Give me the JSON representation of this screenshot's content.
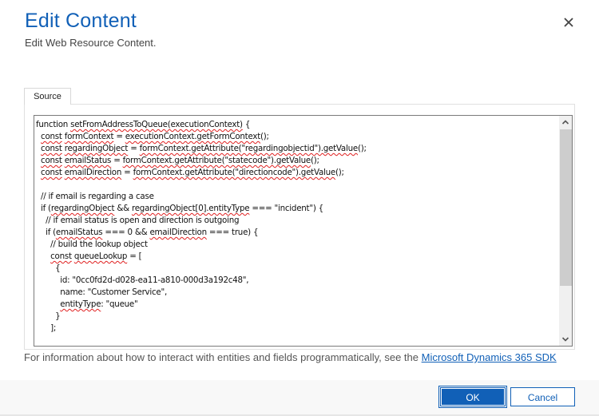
{
  "dialog": {
    "title": "Edit Content",
    "subtitle": "Edit Web Resource Content."
  },
  "tabs": [
    {
      "label": "Source",
      "active": true
    }
  ],
  "editor": {
    "lines": [
      [
        {
          "t": "function "
        },
        {
          "t": "setFromAddressToQueue(executionContext)",
          "sq": true
        },
        {
          "t": " {"
        }
      ],
      [
        {
          "t": "  "
        },
        {
          "t": "const",
          "sq": true
        },
        {
          "t": " "
        },
        {
          "t": "formContext",
          "sq": true
        },
        {
          "t": " = "
        },
        {
          "t": "executionContext.getFormContext",
          "sq": true
        },
        {
          "t": "();"
        }
      ],
      [
        {
          "t": "  "
        },
        {
          "t": "const",
          "sq": true
        },
        {
          "t": " "
        },
        {
          "t": "regardingObject",
          "sq": true
        },
        {
          "t": " = "
        },
        {
          "t": "formContext.getAttribute(\"regardingobjectid\").getValue",
          "sq": true
        },
        {
          "t": "();"
        }
      ],
      [
        {
          "t": "  "
        },
        {
          "t": "const",
          "sq": true
        },
        {
          "t": " "
        },
        {
          "t": "emailStatus",
          "sq": true
        },
        {
          "t": " = "
        },
        {
          "t": "formContext.getAttribute(\"statecode\").getValue",
          "sq": true
        },
        {
          "t": "();"
        }
      ],
      [
        {
          "t": "  "
        },
        {
          "t": "const",
          "sq": true
        },
        {
          "t": " "
        },
        {
          "t": "emailDirection",
          "sq": true
        },
        {
          "t": " = "
        },
        {
          "t": "formContext.getAttribute(\"directioncode\").getValue",
          "sq": true
        },
        {
          "t": "();"
        }
      ],
      [
        {
          "t": ""
        }
      ],
      [
        {
          "t": "  // if email is regarding a case"
        }
      ],
      [
        {
          "t": "  if ("
        },
        {
          "t": "regardingObject",
          "sq": true
        },
        {
          "t": " && "
        },
        {
          "t": "regardingObject[0].entityType",
          "sq": true
        },
        {
          "t": " === \"incident\") {"
        }
      ],
      [
        {
          "t": "    // if email status is open and direction is outgoing"
        }
      ],
      [
        {
          "t": "    if ("
        },
        {
          "t": "emailStatus",
          "sq": true
        },
        {
          "t": " === 0 && "
        },
        {
          "t": "emailDirection",
          "sq": true
        },
        {
          "t": " === true) {"
        }
      ],
      [
        {
          "t": "      // build the lookup object"
        }
      ],
      [
        {
          "t": "      "
        },
        {
          "t": "const",
          "sq": true
        },
        {
          "t": " "
        },
        {
          "t": "queueLookup",
          "sq": true
        },
        {
          "t": " = ["
        }
      ],
      [
        {
          "t": "        {"
        }
      ],
      [
        {
          "t": "          id: \"0cc0fd2d-d028-ea11-a810-000d3a192c48\","
        }
      ],
      [
        {
          "t": "          name: \"Customer Service\","
        }
      ],
      [
        {
          "t": "          "
        },
        {
          "t": "entityType",
          "sq": true
        },
        {
          "t": ": \"queue\""
        }
      ],
      [
        {
          "t": "        }"
        }
      ],
      [
        {
          "t": "      ];"
        }
      ]
    ],
    "scroll_position_fraction": 0.0,
    "visible_fraction": 0.77
  },
  "info": {
    "text": "For information about how to interact with entities and fields programmatically, see the ",
    "link_text": "Microsoft Dynamics 365 SDK"
  },
  "footer": {
    "ok_label": "OK",
    "cancel_label": "Cancel"
  },
  "icons": {
    "close": "close-icon",
    "scroll_up": "chevron-up-icon",
    "scroll_down": "chevron-down-icon"
  },
  "colors": {
    "accent": "#1160b7",
    "squiggle": "#e02020"
  }
}
